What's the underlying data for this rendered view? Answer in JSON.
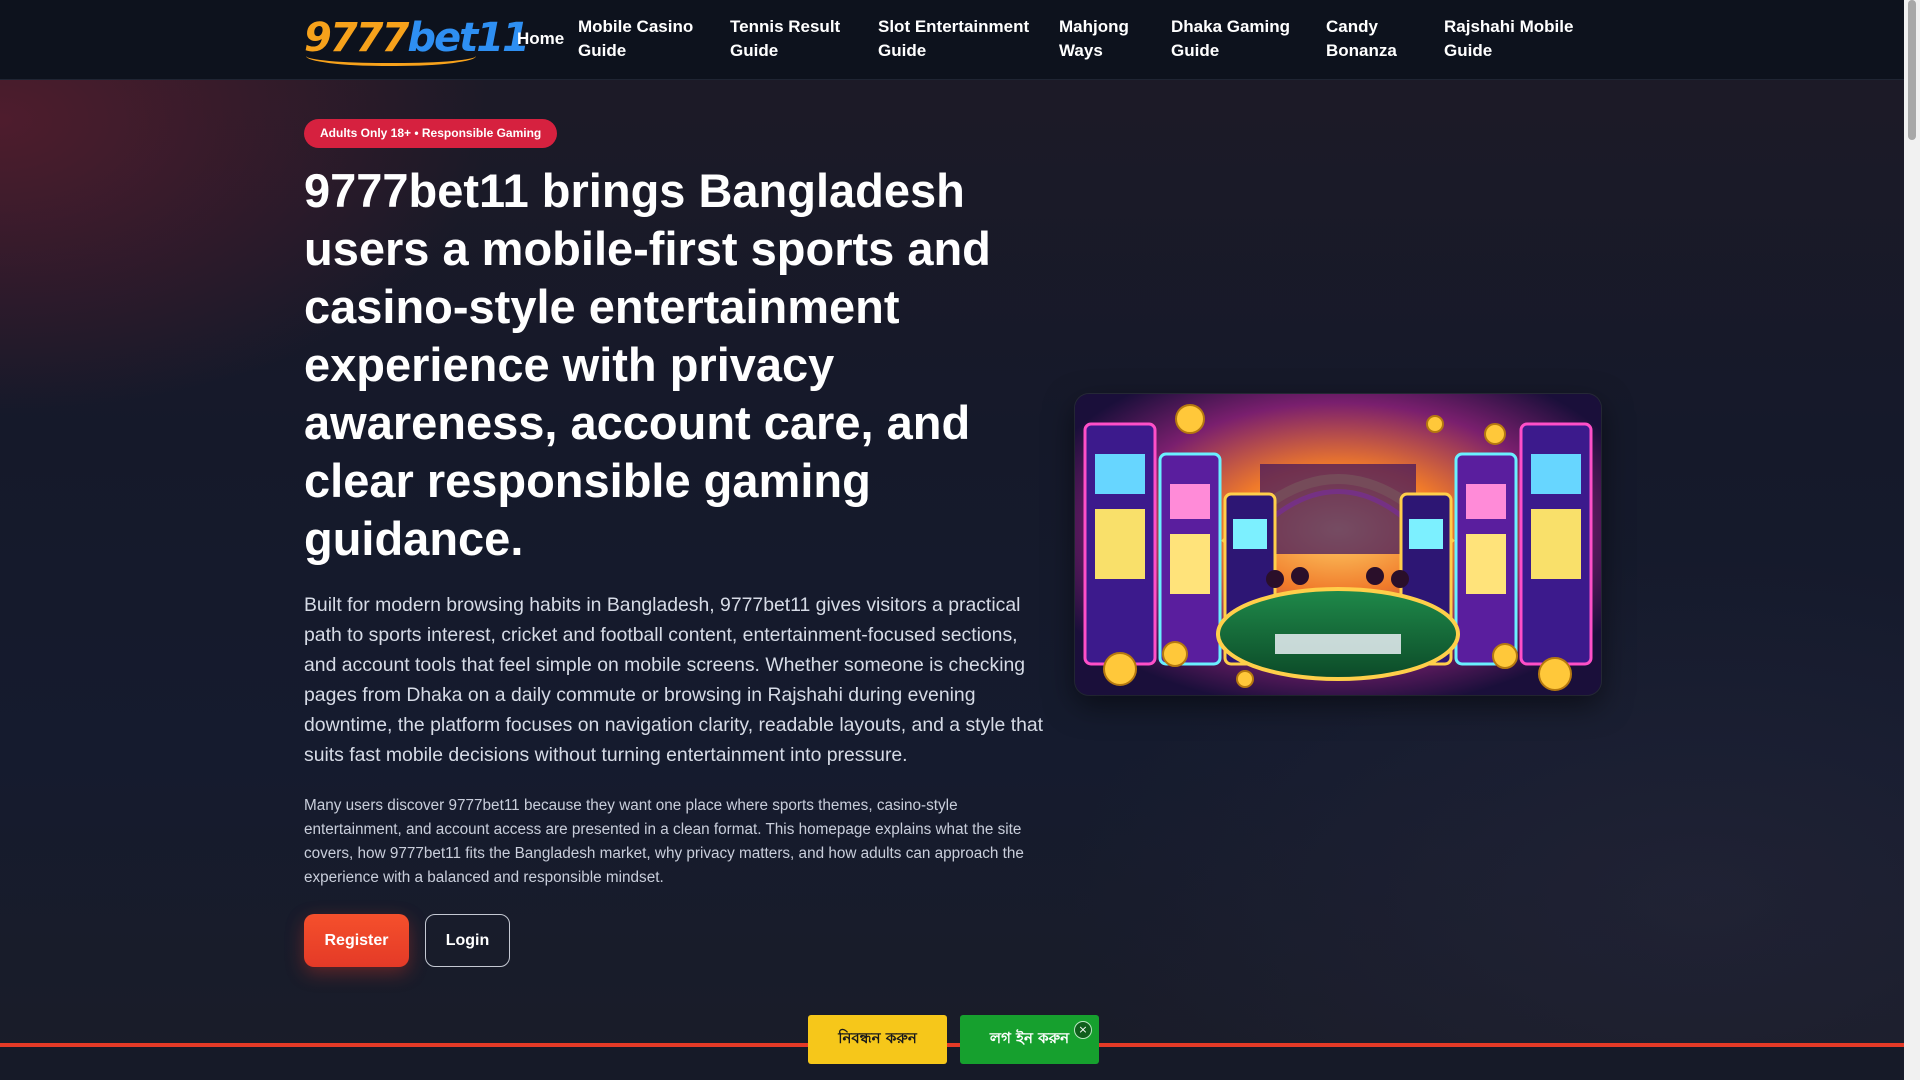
{
  "header": {
    "logo_part1": "9777",
    "logo_part2": "bet11",
    "nav": [
      {
        "label": "Home"
      },
      {
        "label": "Mobile Casino Guide"
      },
      {
        "label": "Tennis Result Guide"
      },
      {
        "label": "Slot Entertainment Guide"
      },
      {
        "label": "Mahjong Ways"
      },
      {
        "label": "Dhaka Gaming Guide"
      },
      {
        "label": "Candy Bonanza"
      },
      {
        "label": "Rajshahi Mobile Guide"
      }
    ]
  },
  "hero": {
    "badge": "Adults Only 18+ • Responsible Gaming",
    "title": "9777bet11 brings Bangladesh users a mobile-first sports and casino-style entertainment experience with privacy awareness, account care, and clear responsible gaming guidance.",
    "lead": "Built for modern browsing habits in Bangladesh, 9777bet11 gives visitors a practical path to sports interest, cricket and football content, entertainment-focused sections, and account tools that feel simple on mobile screens. Whether someone is checking pages from Dhaka on a daily commute or browsing in Rajshahi during evening downtime, the platform focuses on navigation clarity, readable layouts, and a style that suits fast mobile decisions without turning entertainment into pressure.",
    "sub": "Many users discover 9777bet11 because they want one place where sports themes, casino-style entertainment, and account access are presented in a clean format. This homepage explains what the site covers, how 9777bet11 fits the Bangladesh market, why privacy matters, and how adults can approach the experience with a balanced and responsible mindset.",
    "register_label": "Register",
    "login_label": "Login"
  },
  "bottom_bar": {
    "register_bn": "নিবন্ধন করুন",
    "login_bn": "লগ ইন করুন",
    "close_symbol": "×"
  },
  "colors": {
    "accent_red": "#e43a27",
    "badge_red": "#d6213f",
    "cta_yellow": "#f6c71a",
    "cta_green": "#16a02e",
    "logo_orange": "#f7a21b",
    "logo_blue": "#2e8ff2"
  }
}
